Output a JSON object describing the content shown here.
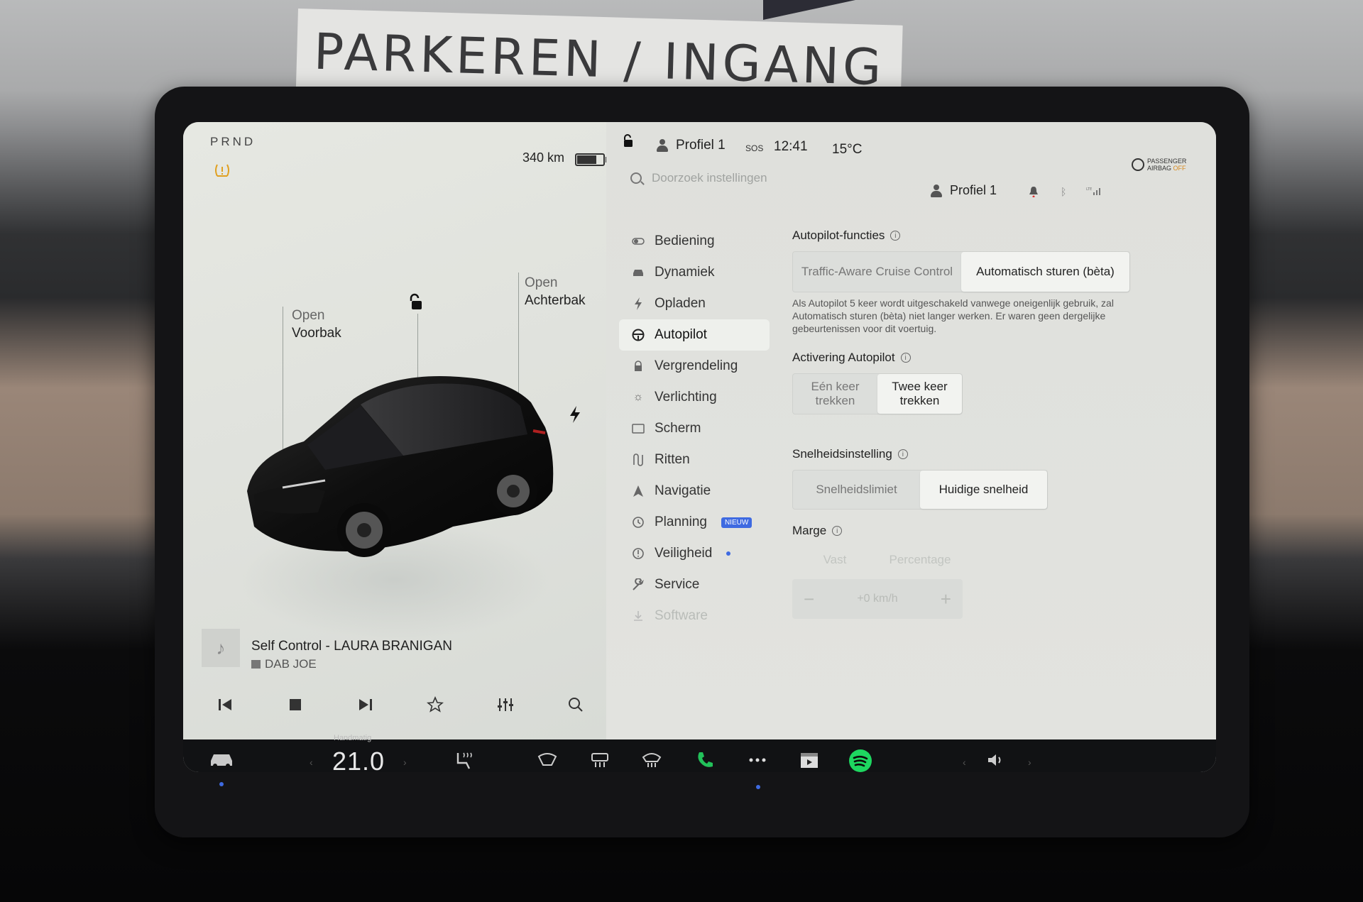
{
  "background": {
    "sign_text": "PARKEREN / INGANG"
  },
  "car_panel": {
    "gear": "PRND",
    "range": "340 km",
    "frunk": {
      "action": "Open",
      "name": "Voorbak"
    },
    "trunk": {
      "action": "Open",
      "name": "Achterbak"
    }
  },
  "media": {
    "track": "Self Control - LAURA BRANIGAN",
    "station": "DAB JOE"
  },
  "status_bar": {
    "profile": "Profiel 1",
    "sos": "SOS",
    "time": "12:41",
    "temperature": "15°C",
    "airbag_line1": "PASSENGER",
    "airbag_line2": "AIRBAG",
    "airbag_state": "OFF"
  },
  "search": {
    "placeholder": "Doorzoek instellingen"
  },
  "profile_header": {
    "name": "Profiel 1"
  },
  "nav": {
    "items": [
      {
        "label": "Bediening",
        "icon": "toggle-icon"
      },
      {
        "label": "Dynamiek",
        "icon": "car-icon"
      },
      {
        "label": "Opladen",
        "icon": "bolt-icon"
      },
      {
        "label": "Autopilot",
        "icon": "steering-wheel-icon",
        "active": true
      },
      {
        "label": "Vergrendeling",
        "icon": "lock-icon"
      },
      {
        "label": "Verlichting",
        "icon": "sun-icon"
      },
      {
        "label": "Scherm",
        "icon": "display-icon"
      },
      {
        "label": "Ritten",
        "icon": "trips-icon"
      },
      {
        "label": "Navigatie",
        "icon": "navigation-icon"
      },
      {
        "label": "Planning",
        "icon": "clock-icon",
        "badge": "NIEUW"
      },
      {
        "label": "Veiligheid",
        "icon": "info-circle-icon"
      },
      {
        "label": "Service",
        "icon": "wrench-icon"
      },
      {
        "label": "Software",
        "icon": "download-icon"
      }
    ]
  },
  "autopilot": {
    "features_title": "Autopilot-functies",
    "features_options": [
      "Traffic-Aware Cruise Control",
      "Automatisch sturen (bèta)"
    ],
    "features_selected": 1,
    "note": "Als Autopilot 5 keer wordt uitgeschakeld vanwege oneigenlijk gebruik, zal Automatisch sturen (bèta) niet langer werken. Er waren geen dergelijke gebeurtenissen voor dit voertuig.",
    "activation_title": "Activering Autopilot",
    "activation_options": [
      "Eén keer trekken",
      "Twee keer trekken"
    ],
    "activation_selected": 1,
    "speed_title": "Snelheidsinstelling",
    "speed_options": [
      "Snelheidslimiet",
      "Huidige snelheid"
    ],
    "speed_selected": 1,
    "margin_title": "Marge",
    "margin_options": [
      "Vast",
      "Percentage"
    ],
    "margin_value": "+0 km/h",
    "margin_minus": "−",
    "margin_plus": "+"
  },
  "bottom_bar": {
    "temp_mode": "Handmatig",
    "temp_value": "21.0"
  },
  "colors": {
    "accent_blue": "#3e6ae1",
    "phone_green": "#22c15a",
    "spotify_green": "#1ed760",
    "warning_amber": "#e0a020"
  }
}
